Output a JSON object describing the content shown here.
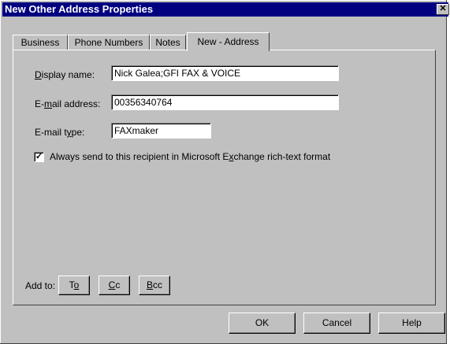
{
  "window": {
    "title": "New Other Address Properties",
    "close_glyph": "✕"
  },
  "tabs": [
    {
      "label": "Business"
    },
    {
      "label": "Phone Numbers"
    },
    {
      "label": "Notes"
    },
    {
      "label": "New - Address",
      "active": true
    }
  ],
  "form": {
    "display_name_label": {
      "pre": "",
      "key": "D",
      "post": "isplay name:"
    },
    "display_name_value": "Nick Galea;GFI FAX & VOICE",
    "email_label": {
      "pre": "E-",
      "key": "m",
      "post": "ail address:"
    },
    "email_value": "00356340764",
    "type_label": {
      "pre": "E-mail t",
      "key": "y",
      "post": "pe:"
    },
    "type_value": "FAXmaker",
    "richtext_checked": true,
    "richtext_label": {
      "pre": "Always send to this recipient in Microsoft E",
      "key": "x",
      "post": "change rich-text format"
    }
  },
  "add_to": {
    "label": "Add to:",
    "to": {
      "pre": "T",
      "key": "o",
      "post": ""
    },
    "cc": {
      "pre": "",
      "key": "C",
      "post": "c"
    },
    "bcc": {
      "pre": "",
      "key": "B",
      "post": "cc"
    }
  },
  "buttons": {
    "ok": "OK",
    "cancel": "Cancel",
    "help": "Help"
  },
  "colors": {
    "face": "#c0c0c0",
    "titlebar": "#000080",
    "title_text": "#ffffff"
  }
}
